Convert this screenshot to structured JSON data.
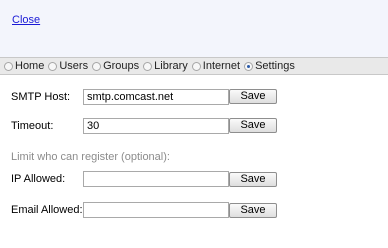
{
  "top": {
    "close_label": "Close"
  },
  "nav": {
    "items": [
      {
        "label": "Home",
        "selected": false
      },
      {
        "label": "Users",
        "selected": false
      },
      {
        "label": "Groups",
        "selected": false
      },
      {
        "label": "Library",
        "selected": false
      },
      {
        "label": "Internet",
        "selected": false
      },
      {
        "label": "Settings",
        "selected": true
      }
    ]
  },
  "settings": {
    "smtp_host": {
      "label": "SMTP Host:",
      "value": "smtp.comcast.net",
      "button": "Save"
    },
    "timeout": {
      "label": "Timeout:",
      "value": "30",
      "button": "Save"
    },
    "register_hint": "Limit who can register (optional):",
    "ip_allowed": {
      "label": "IP Allowed:",
      "value": "",
      "button": "Save"
    },
    "email_allowed": {
      "label": "Email Allowed:",
      "value": "",
      "button": "Save"
    }
  },
  "colors": {
    "link": "#1a1ad6",
    "top_bar_bg": "#f3f5fc",
    "nav_bg": "#e9e9e9",
    "hint_text": "#8c8c8c"
  }
}
